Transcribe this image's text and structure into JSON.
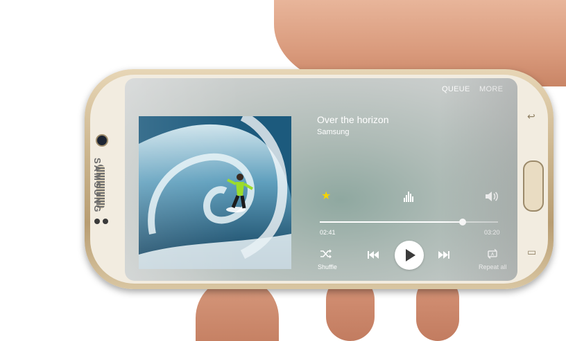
{
  "phone": {
    "brand": "SAMSUNG"
  },
  "player": {
    "top_actions": {
      "queue": "QUEUE",
      "more": "MORE"
    },
    "song_title": "Over the horizon",
    "artist": "Samsung",
    "favorite": true,
    "progress": {
      "elapsed": "02:41",
      "duration": "03:20",
      "fraction": 0.8
    },
    "controls": {
      "shuffle_label": "Shuffle",
      "repeat_label": "Repeat all"
    },
    "icons": {
      "favorite": "star-icon",
      "equalizer": "equalizer-icon",
      "volume": "volume-icon",
      "shuffle": "shuffle-icon",
      "previous": "previous-icon",
      "play": "play-icon",
      "next": "next-icon",
      "repeat": "repeat-icon"
    },
    "colors": {
      "favorite_star": "#f5d400",
      "text": "#ffffff"
    }
  }
}
